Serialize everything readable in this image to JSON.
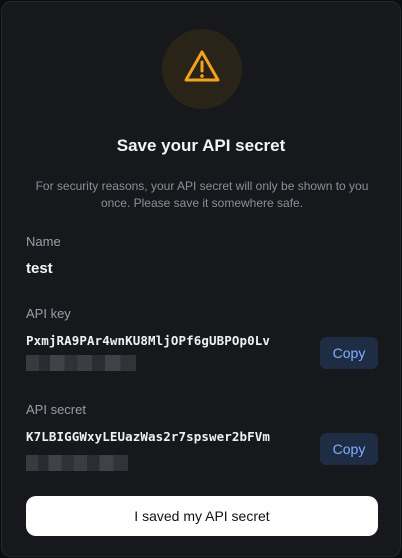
{
  "dialog": {
    "title": "Save your API secret",
    "description": "For security reasons, your API secret will only be shown to you once. Please save it somewhere safe.",
    "icon": "warning-triangle-icon",
    "accent_color": "#f0a31c"
  },
  "fields": {
    "name": {
      "label": "Name",
      "value": "test"
    },
    "api_key": {
      "label": "API key",
      "value": "PxmjRA9PAr4wnKU8MljOPf6gUBPOp0Lv",
      "copy_label": "Copy"
    },
    "api_secret": {
      "label": "API secret",
      "value": "K7LBIGGWxyLEUazWas2r7spswer2bFVm",
      "copy_label": "Copy"
    }
  },
  "actions": {
    "confirm_label": "I saved my API secret"
  }
}
